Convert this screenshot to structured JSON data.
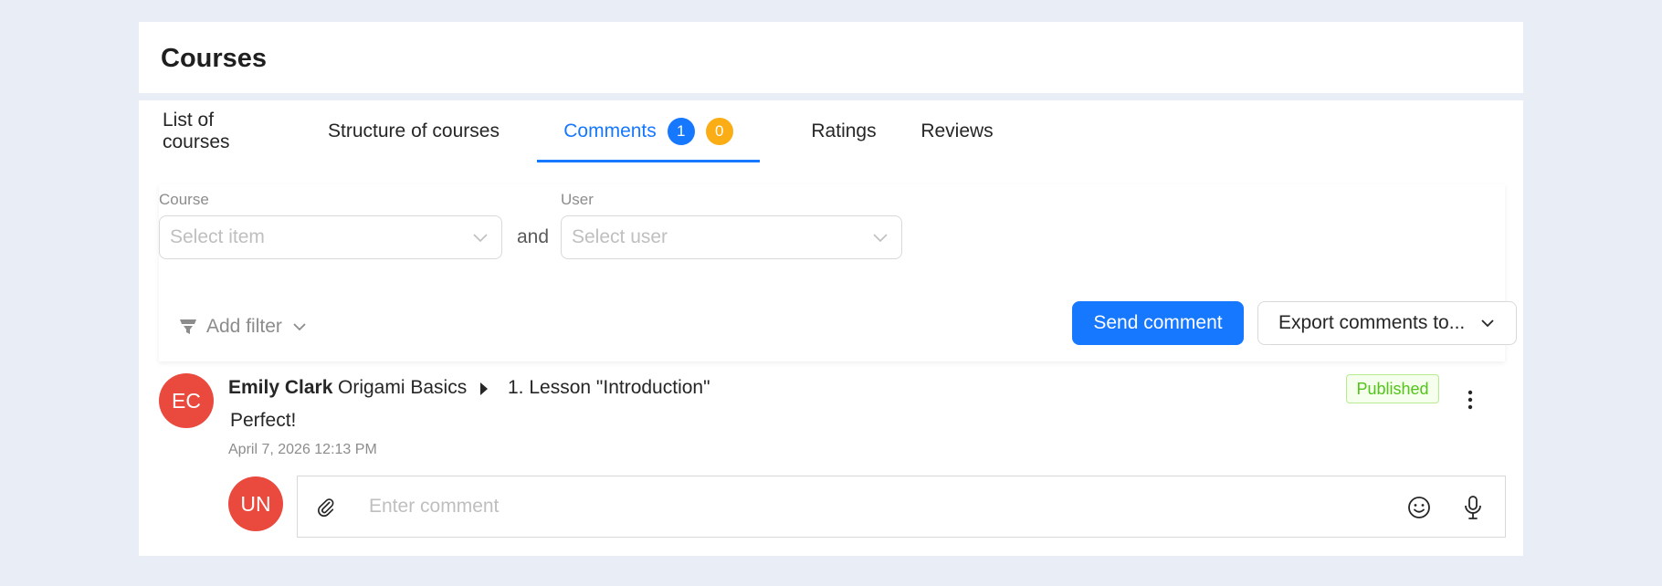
{
  "header": {
    "title": "Courses"
  },
  "tabs": [
    {
      "label": "List of courses"
    },
    {
      "label": "Structure of courses"
    },
    {
      "label": "Comments",
      "badge_blue": "1",
      "badge_orange": "0",
      "active": true
    },
    {
      "label": "Ratings"
    },
    {
      "label": "Reviews"
    }
  ],
  "filters": {
    "course_label": "Course",
    "course_placeholder": "Select item",
    "conjunction": "and",
    "user_label": "User",
    "user_placeholder": "Select user",
    "add_filter_label": "Add filter"
  },
  "actions": {
    "send_label": "Send comment",
    "export_label": "Export comments to..."
  },
  "comment": {
    "avatar_initials": "EC",
    "author": "Emily Clark",
    "course": "Origami Basics",
    "lesson": "1. Lesson \"Introduction\"",
    "text": "Perfect!",
    "timestamp": "April 7, 2026 12:13 PM",
    "status": "Published"
  },
  "reply": {
    "avatar_initials": "UN",
    "placeholder": "Enter comment"
  },
  "colors": {
    "accent": "#1677ff",
    "badge_orange": "#faad14",
    "avatar": "#ea4a3e",
    "status_green": "#52c41a",
    "background": "#e9edf5"
  },
  "icons": [
    "chevron-down-icon",
    "filter-icon",
    "caret-right-icon",
    "more-vertical-icon",
    "paperclip-icon",
    "smile-icon",
    "microphone-icon"
  ]
}
